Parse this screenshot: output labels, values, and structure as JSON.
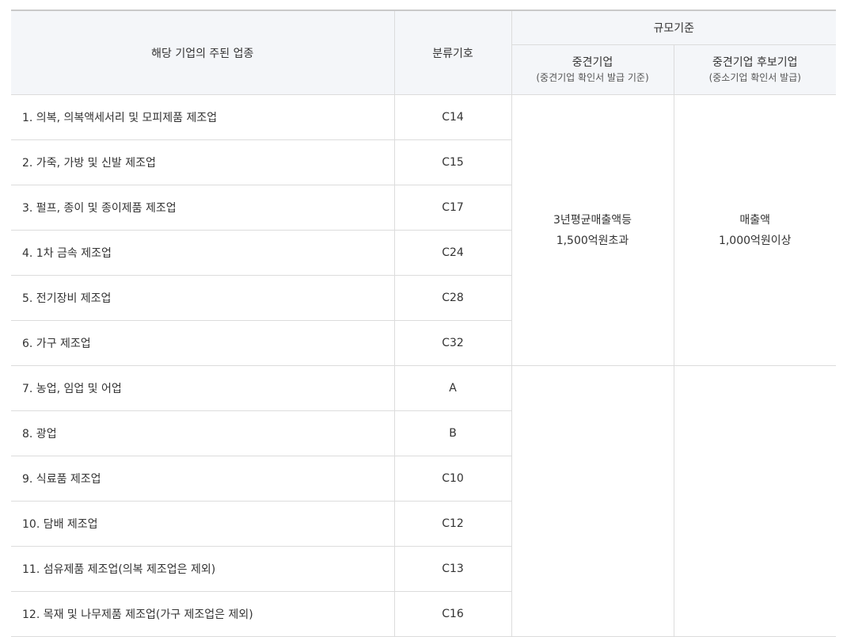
{
  "header": {
    "industry": "해당 기업의 주된 업종",
    "code": "분류기호",
    "scale_group": "규모기준",
    "midsize": {
      "title": "중견기업",
      "note": "(중견기업 확인서 발급 기준)"
    },
    "candidate": {
      "title": "중견기업 후보기업",
      "note": "(중소기업 확인서 발급)"
    }
  },
  "groups": [
    {
      "midsize_criteria": [
        "3년평균매출액등",
        "1,500억원초과"
      ],
      "candidate_criteria": [
        "매출액",
        "1,000억원이상"
      ],
      "rows": [
        {
          "industry": "1. 의복, 의복액세서리 및 모피제품 제조업",
          "code": "C14"
        },
        {
          "industry": "2. 가죽, 가방 및 신발 제조업",
          "code": "C15"
        },
        {
          "industry": "3. 펄프, 종이 및 종이제품 제조업",
          "code": "C17"
        },
        {
          "industry": "4. 1차 금속 제조업",
          "code": "C24"
        },
        {
          "industry": "5. 전기장비 제조업",
          "code": "C28"
        },
        {
          "industry": "6. 가구 제조업",
          "code": "C32"
        }
      ]
    },
    {
      "midsize_criteria": [],
      "candidate_criteria": [],
      "rows": [
        {
          "industry": "7. 농업, 임업 및 어업",
          "code": "A"
        },
        {
          "industry": "8. 광업",
          "code": "B"
        },
        {
          "industry": "9. 식료품 제조업",
          "code": "C10"
        },
        {
          "industry": "10. 담배 제조업",
          "code": "C12"
        },
        {
          "industry": "11. 섬유제품 제조업(의복 제조업은 제외)",
          "code": "C13"
        },
        {
          "industry": "12. 목재 및 나무제품 제조업(가구 제조업은 제외)",
          "code": "C16"
        }
      ]
    }
  ]
}
